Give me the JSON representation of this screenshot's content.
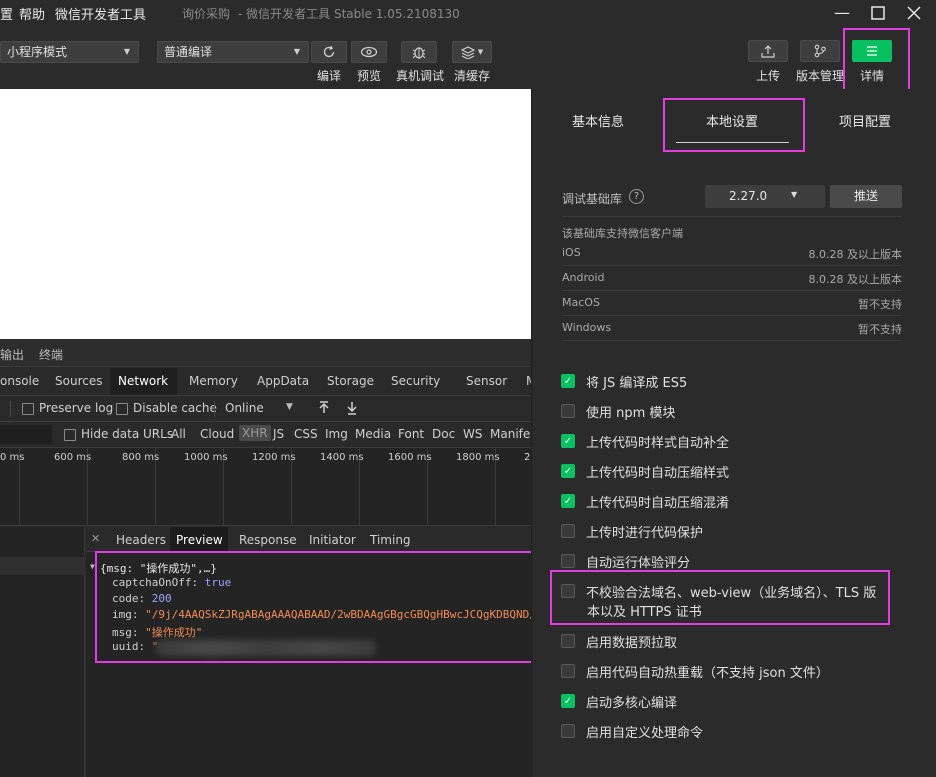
{
  "titlebar": {
    "menu": [
      "置",
      "帮助",
      "微信开发者工具"
    ],
    "project": "询价采购",
    "app_title": "- 微信开发者工具 Stable 1.05.2108130",
    "controls": [
      "—",
      "☐",
      "✕"
    ]
  },
  "toolbar": {
    "mode_select": "小程序模式",
    "compile_select": "普通编译",
    "buttons": {
      "compile": "编译",
      "preview": "预览",
      "real_debug": "真机调试",
      "clear_cache": "清缓存",
      "upload": "上传",
      "version": "版本管理",
      "details": "详情"
    }
  },
  "devtools": {
    "top_tabs": [
      "输出",
      "终端"
    ],
    "panels": [
      "onsole",
      "Sources",
      "Network",
      "Memory",
      "AppData",
      "Storage",
      "Security",
      "Sensor",
      "M"
    ],
    "active_panel": "Network",
    "row1": {
      "preserve_log": "Preserve log",
      "disable_cache": "Disable cache",
      "throttle": "Online"
    },
    "row2": {
      "hide_data_urls": "Hide data URLs",
      "filters": [
        "All",
        "Cloud",
        "XHR",
        "JS",
        "CSS",
        "Img",
        "Media",
        "Font",
        "Doc",
        "WS",
        "Manifes"
      ],
      "active_filter": "XHR"
    },
    "timeline_ticks": [
      "0 ms",
      "600 ms",
      "800 ms",
      "1000 ms",
      "1200 ms",
      "1400 ms",
      "1600 ms",
      "1800 ms",
      "2"
    ],
    "preview_tabs": [
      "Headers",
      "Preview",
      "Response",
      "Initiator",
      "Timing"
    ],
    "active_preview_tab": "Preview",
    "preview": {
      "root": "{msg: \"操作成功\",…}",
      "fields": [
        {
          "key": "captchaOnOff:",
          "value": "true",
          "type": "bool"
        },
        {
          "key": "code:",
          "value": "200",
          "type": "num"
        },
        {
          "key": "img:",
          "value": "\"/9j/4AAQSkZJRgABAgAAAQABAAD/2wBDAAgGBgcGBQgHBwcJCQgKDBQND/",
          "type": "str"
        },
        {
          "key": "msg:",
          "value": "\"操作成功\"",
          "type": "str"
        },
        {
          "key": "uuid:",
          "value": "\"",
          "type": "str"
        }
      ]
    }
  },
  "details": {
    "tabs": [
      "基本信息",
      "本地设置",
      "项目配置"
    ],
    "active_tab": "本地设置",
    "lib_label": "调试基础库",
    "lib_version": "2.27.0",
    "push_button": "推送",
    "support_title": "该基础库支持微信客户端",
    "support": [
      {
        "os": "iOS",
        "ver": "8.0.28 及以上版本"
      },
      {
        "os": "Android",
        "ver": "8.0.28 及以上版本"
      },
      {
        "os": "MacOS",
        "ver": "暂不支持"
      },
      {
        "os": "Windows",
        "ver": "暂不支持"
      }
    ],
    "options": [
      {
        "label": "将 JS 编译成 ES5",
        "checked": true
      },
      {
        "label": "使用 npm 模块",
        "checked": false
      },
      {
        "label": "上传代码时样式自动补全",
        "checked": true
      },
      {
        "label": "上传代码时自动压缩样式",
        "checked": true
      },
      {
        "label": "上传代码时自动压缩混淆",
        "checked": true
      },
      {
        "label": "上传时进行代码保护",
        "checked": false
      },
      {
        "label": "自动运行体验评分",
        "checked": false
      },
      {
        "label": "不校验合法域名、web-view（业务域名）、TLS 版",
        "label2": "本以及 HTTPS 证书",
        "checked": false
      },
      {
        "label": "启用数据预拉取",
        "checked": false
      },
      {
        "label": "启用代码自动热重载（不支持 json 文件）",
        "checked": false
      },
      {
        "label": "启动多核心编译",
        "checked": true
      },
      {
        "label": "启用自定义处理命令",
        "checked": false
      }
    ]
  },
  "colors": {
    "accent_green": "#07c160",
    "highlight": "#e23de2",
    "bg_dark": "#2b2b2b"
  }
}
